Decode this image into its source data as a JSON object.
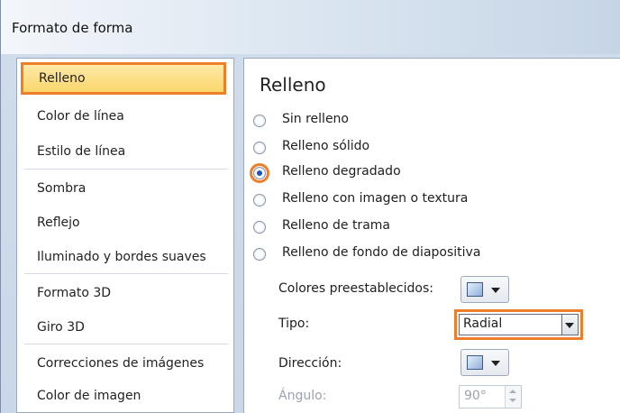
{
  "window": {
    "title": "Formato de forma"
  },
  "sidebar": {
    "items": [
      {
        "label": "Relleno",
        "selected": true
      },
      {
        "label": "Color de línea"
      },
      {
        "label": "Estilo de línea"
      },
      {
        "label": "Sombra"
      },
      {
        "label": "Reflejo"
      },
      {
        "label": "Iluminado y bordes suaves"
      },
      {
        "label": "Formato 3D"
      },
      {
        "label": "Giro 3D"
      },
      {
        "label": "Correcciones de imágenes"
      },
      {
        "label": "Color de imagen"
      }
    ]
  },
  "panel": {
    "title": "Relleno",
    "fill_options": [
      {
        "label": "Sin relleno",
        "selected": false
      },
      {
        "label": "Relleno sólido",
        "selected": false
      },
      {
        "label": "Relleno degradado",
        "selected": true
      },
      {
        "label": "Relleno con imagen o textura",
        "selected": false
      },
      {
        "label": "Relleno de trama",
        "selected": false
      },
      {
        "label": "Relleno de fondo de diapositiva",
        "selected": false
      }
    ],
    "preset_colors_label": "Colores preestablecidos:",
    "type_label": "Tipo:",
    "type_value": "Radial",
    "direction_label": "Dirección:",
    "angle_label": "Ángulo:",
    "angle_value": "90°"
  },
  "colors": {
    "accent_highlight": "#ee7f2a",
    "selection_fill": "#fbd66a"
  }
}
